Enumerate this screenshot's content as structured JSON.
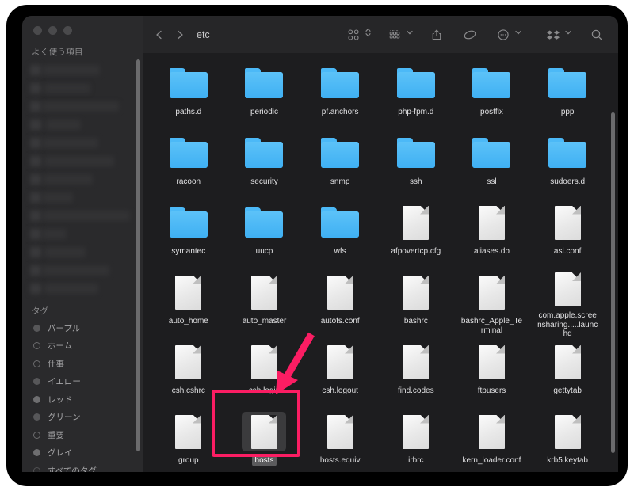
{
  "window": {
    "traffic_lights": [
      "close",
      "minimize",
      "zoom"
    ],
    "path_title": "etc"
  },
  "sidebar": {
    "favorites_header": "よく使う項目",
    "favorites_blurred_count": 13,
    "tags_header": "タグ",
    "tags": [
      {
        "label": "パープル",
        "dot": "mesh"
      },
      {
        "label": "ホーム",
        "dot": "hollow"
      },
      {
        "label": "仕事",
        "dot": "hollow"
      },
      {
        "label": "イエロー",
        "dot": "mesh"
      },
      {
        "label": "レッド",
        "dot": "filled"
      },
      {
        "label": "グリーン",
        "dot": "mesh"
      },
      {
        "label": "重要",
        "dot": "hollow"
      },
      {
        "label": "グレイ",
        "dot": "filled"
      },
      {
        "label": "すべてのタグ…",
        "dot": "all"
      }
    ]
  },
  "toolbar": {
    "back_label": "戻る",
    "forward_label": "進む",
    "view_label": "表示方法",
    "group_label": "グループ分け",
    "share_label": "共有",
    "tag_label": "タグ",
    "action_label": "操作",
    "dropbox_label": "Dropbox",
    "search_label": "検索"
  },
  "files": [
    {
      "name": "paths.d",
      "type": "folder"
    },
    {
      "name": "periodic",
      "type": "folder"
    },
    {
      "name": "pf.anchors",
      "type": "folder"
    },
    {
      "name": "php-fpm.d",
      "type": "folder"
    },
    {
      "name": "postfix",
      "type": "folder"
    },
    {
      "name": "ppp",
      "type": "folder"
    },
    {
      "name": "racoon",
      "type": "folder"
    },
    {
      "name": "security",
      "type": "folder"
    },
    {
      "name": "snmp",
      "type": "folder"
    },
    {
      "name": "ssh",
      "type": "folder"
    },
    {
      "name": "ssl",
      "type": "folder"
    },
    {
      "name": "sudoers.d",
      "type": "folder"
    },
    {
      "name": "symantec",
      "type": "folder"
    },
    {
      "name": "uucp",
      "type": "folder"
    },
    {
      "name": "wfs",
      "type": "folder"
    },
    {
      "name": "afpovertcp.cfg",
      "type": "document"
    },
    {
      "name": "aliases.db",
      "type": "document"
    },
    {
      "name": "asl.conf",
      "type": "document"
    },
    {
      "name": "auto_home",
      "type": "document"
    },
    {
      "name": "auto_master",
      "type": "document"
    },
    {
      "name": "autofs.conf",
      "type": "document"
    },
    {
      "name": "bashrc",
      "type": "document"
    },
    {
      "name": "bashrc_Apple_Terminal",
      "type": "document"
    },
    {
      "name": "com.apple.screensharing.....launchd",
      "type": "document"
    },
    {
      "name": "csh.cshrc",
      "type": "document"
    },
    {
      "name": "csh.login",
      "type": "document"
    },
    {
      "name": "csh.logout",
      "type": "document"
    },
    {
      "name": "find.codes",
      "type": "document"
    },
    {
      "name": "ftpusers",
      "type": "document"
    },
    {
      "name": "gettytab",
      "type": "document"
    },
    {
      "name": "group",
      "type": "document"
    },
    {
      "name": "hosts",
      "type": "document",
      "selected": true
    },
    {
      "name": "hosts.equiv",
      "type": "document"
    },
    {
      "name": "irbrc",
      "type": "document"
    },
    {
      "name": "kern_loader.conf",
      "type": "document"
    },
    {
      "name": "krb5.keytab",
      "type": "document"
    }
  ],
  "annotation": {
    "highlight_target": "hosts",
    "color": "#fb1d63",
    "arrow": "down-left-arrow"
  },
  "colors": {
    "folder_blue": "#4cb9f7",
    "window_bg": "#1d1d1f",
    "sidebar_bg": "#2a2a2c",
    "toolbar_bg": "#262628",
    "accent_pink": "#fb1d63"
  }
}
